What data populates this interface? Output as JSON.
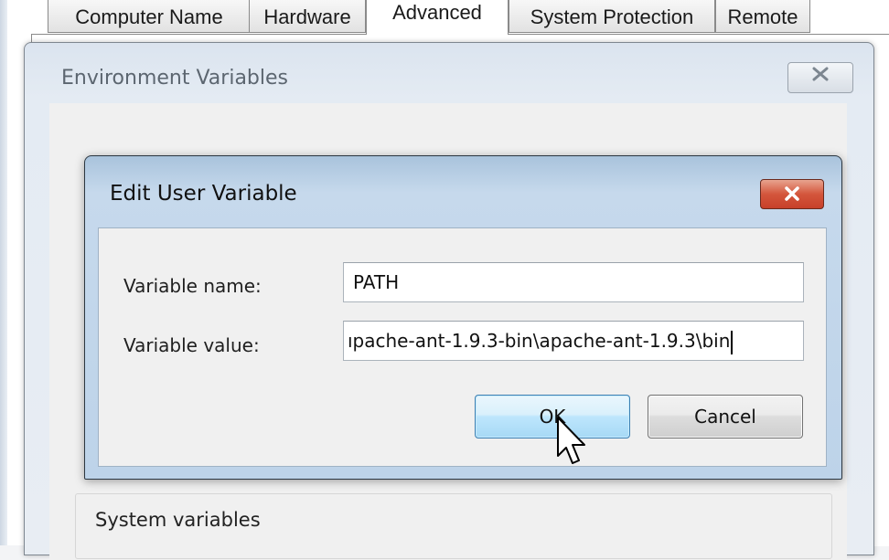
{
  "system_properties": {
    "tabs": [
      {
        "label": "Computer Name"
      },
      {
        "label": "Hardware"
      },
      {
        "label": "Advanced",
        "active": true
      },
      {
        "label": "System Protection"
      },
      {
        "label": "Remote"
      }
    ]
  },
  "env_window": {
    "title": "Environment Variables",
    "close_icon": "close-icon",
    "system_variables_label": "System variables"
  },
  "edit_dialog": {
    "title": "Edit User Variable",
    "close_icon": "close-icon",
    "variable_name_label": "Variable name:",
    "variable_name_value": "PATH",
    "variable_value_label": "Variable value:",
    "variable_value_value": "ıpache-ant-1.9.3-bin\\apache-ant-1.9.3\\bin",
    "ok_label": "OK",
    "cancel_label": "Cancel"
  },
  "colors": {
    "close_button_red": "#d4563c",
    "ok_button_blue": "#bee6fd",
    "dialog_frame": "#bdd3e9"
  }
}
